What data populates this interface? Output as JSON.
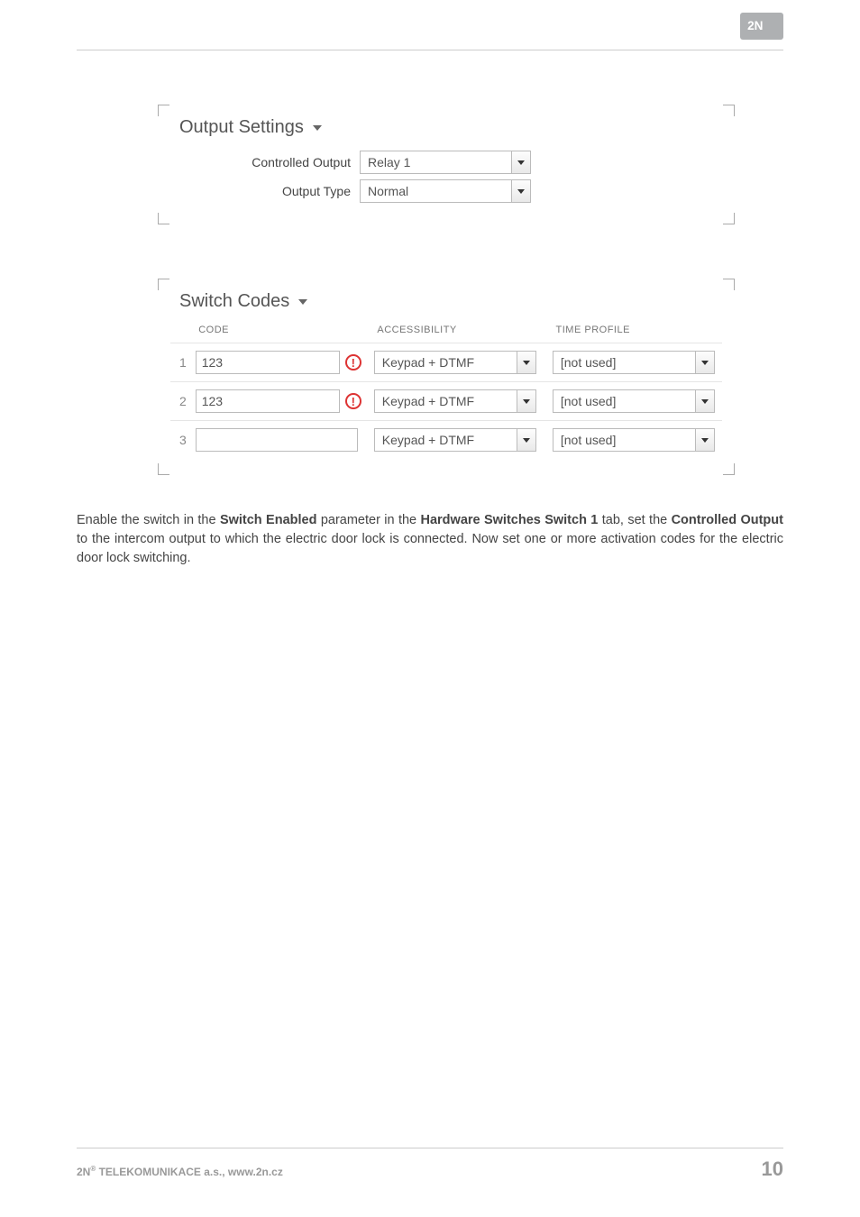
{
  "sections": {
    "output": {
      "title": "Output Settings",
      "rows": [
        {
          "label": "Controlled Output",
          "value": "Relay 1"
        },
        {
          "label": "Output Type",
          "value": "Normal"
        }
      ]
    },
    "codes": {
      "title": "Switch Codes",
      "headers": {
        "code": "CODE",
        "accessibility": "ACCESSIBILITY",
        "time_profile": "TIME PROFILE"
      },
      "rows": [
        {
          "idx": "1",
          "code": "123",
          "warn": true,
          "accessibility": "Keypad + DTMF",
          "time_profile": "[not used]"
        },
        {
          "idx": "2",
          "code": "123",
          "warn": true,
          "accessibility": "Keypad + DTMF",
          "time_profile": "[not used]"
        },
        {
          "idx": "3",
          "code": "",
          "warn": false,
          "accessibility": "Keypad + DTMF",
          "time_profile": "[not used]"
        }
      ]
    }
  },
  "paragraph": {
    "p1a": "Enable the switch in the ",
    "p1b": "Switch Enabled",
    "p1c": " parameter in the ",
    "p1d": "Hardware  Switches  Switch 1",
    "p1e": " tab, set the ",
    "p1f": "Controlled Output",
    "p1g": " to the intercom output to which the electric door lock is connected. Now set one or more activation codes for the electric door lock switching."
  },
  "footer": {
    "company": "2N",
    "reg": "®",
    "rest": " TELEKOMUNIKACE a.s., www.2n.cz",
    "page": "10"
  }
}
